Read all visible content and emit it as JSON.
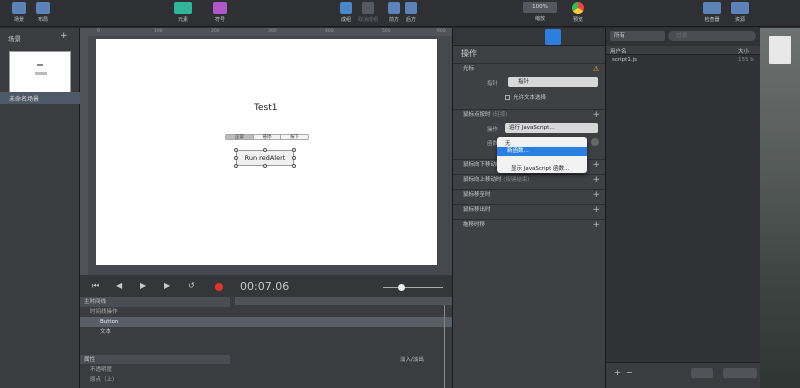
{
  "toolbar": {
    "scene_label": "场景",
    "layout_label": "布局",
    "element_label": "元素",
    "symbol_label": "符号",
    "group_label": "成组",
    "ungroup_label": "取消成组",
    "front_label": "前方",
    "back_label": "后方",
    "zoom_value": "100%",
    "zoom_label": "缩放",
    "preview_label": "预览",
    "inspector_label": "检查器",
    "library_label": "资源"
  },
  "scenes": {
    "title": "场景",
    "add": "+",
    "scene_name": "未命名场景"
  },
  "stage": {
    "ruler_marks": [
      "0",
      "100",
      "200",
      "300",
      "400",
      "500",
      "600"
    ],
    "title_text": "Test1",
    "seg_labels": [
      "正常",
      "悬停",
      "按下"
    ],
    "button_text": "Run redAlert"
  },
  "timeline": {
    "time": "00:07.06",
    "main_timeline": "主时间线",
    "timeline_actions": "时间线操作",
    "rows": [
      {
        "name": "Button"
      },
      {
        "name": "文本"
      }
    ],
    "props_header": "属性",
    "easing_label": "淡入/淡出",
    "prop_rows": [
      "不透明度",
      "原点（上）"
    ]
  },
  "inspector": {
    "title": "操作",
    "cursor_section": "光标",
    "pointer_label": "指针",
    "pointer_value": "指针",
    "allow_text_select": "允许文本选择",
    "on_click_section": "鼠标点按时",
    "on_click_hint": "(轻按)",
    "action_label": "操作",
    "action_value": "运行 JavaScript...",
    "function_label": "函数",
    "dropdown_items": [
      "无",
      "新函数..."
    ],
    "show_js_functions": "显示 JavaScript 函数...",
    "mouse_down": "鼠标向下移动时",
    "mouse_up": "鼠标向上移动时",
    "mouse_up_hint": "(按键结束)",
    "mouse_enter": "鼠标移至时",
    "mouse_exit": "鼠标移出时",
    "drag": "拖移时移"
  },
  "library": {
    "filter_value": "所有",
    "search_placeholder": "过滤",
    "col_name": "用户名",
    "col_size": "大小",
    "files": [
      {
        "name": "script1.js",
        "size": "155 b"
      }
    ]
  },
  "colors": {
    "accent": "#2a7fe0",
    "record": "#e0342a",
    "warning": "#f0c020"
  }
}
